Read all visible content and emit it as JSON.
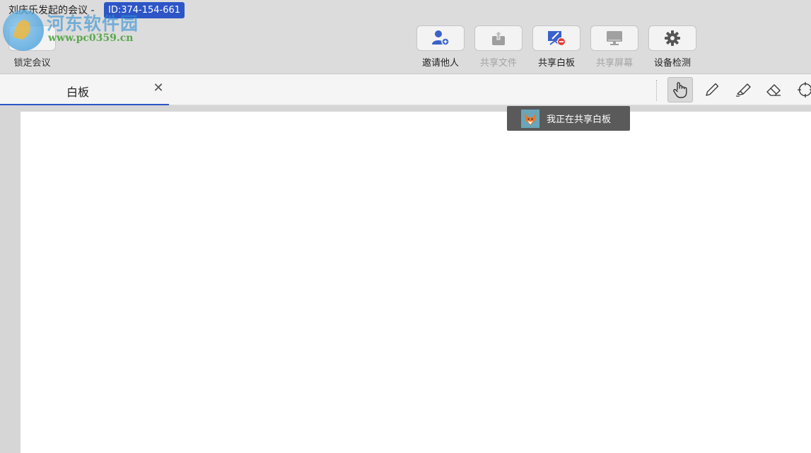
{
  "header": {
    "meeting_title": "刘庆乐发起的会议 -",
    "meeting_id": "ID:374-154-661",
    "lock_label": "锁定会议",
    "tools": [
      {
        "label": "邀请他人",
        "icon": "invite-user-icon",
        "enabled": true
      },
      {
        "label": "共享文件",
        "icon": "share-file-icon",
        "enabled": false
      },
      {
        "label": "共享白板",
        "icon": "whiteboard-icon",
        "enabled": true
      },
      {
        "label": "共享屏幕",
        "icon": "share-screen-icon",
        "enabled": false
      },
      {
        "label": "设备检测",
        "icon": "gear-icon",
        "enabled": true
      }
    ]
  },
  "watermark": {
    "name": "河东软件园",
    "url": "www.pc0359.cn"
  },
  "tabs": [
    {
      "label": "白板",
      "close": "✕",
      "active": true
    }
  ],
  "whiteboard_tools": [
    {
      "name": "hand-icon",
      "active": true
    },
    {
      "name": "pencil-icon",
      "active": false
    },
    {
      "name": "highlighter-icon",
      "active": false
    },
    {
      "name": "eraser-icon",
      "active": false
    },
    {
      "name": "crosshair-icon",
      "active": false
    }
  ],
  "toast": {
    "text": "我正在共享白板"
  },
  "colors": {
    "accent": "#2d55c6",
    "header_bg": "#dcdcdc",
    "toast_bg": "#5a5a5a",
    "disabled_text": "#a3a3a3"
  }
}
